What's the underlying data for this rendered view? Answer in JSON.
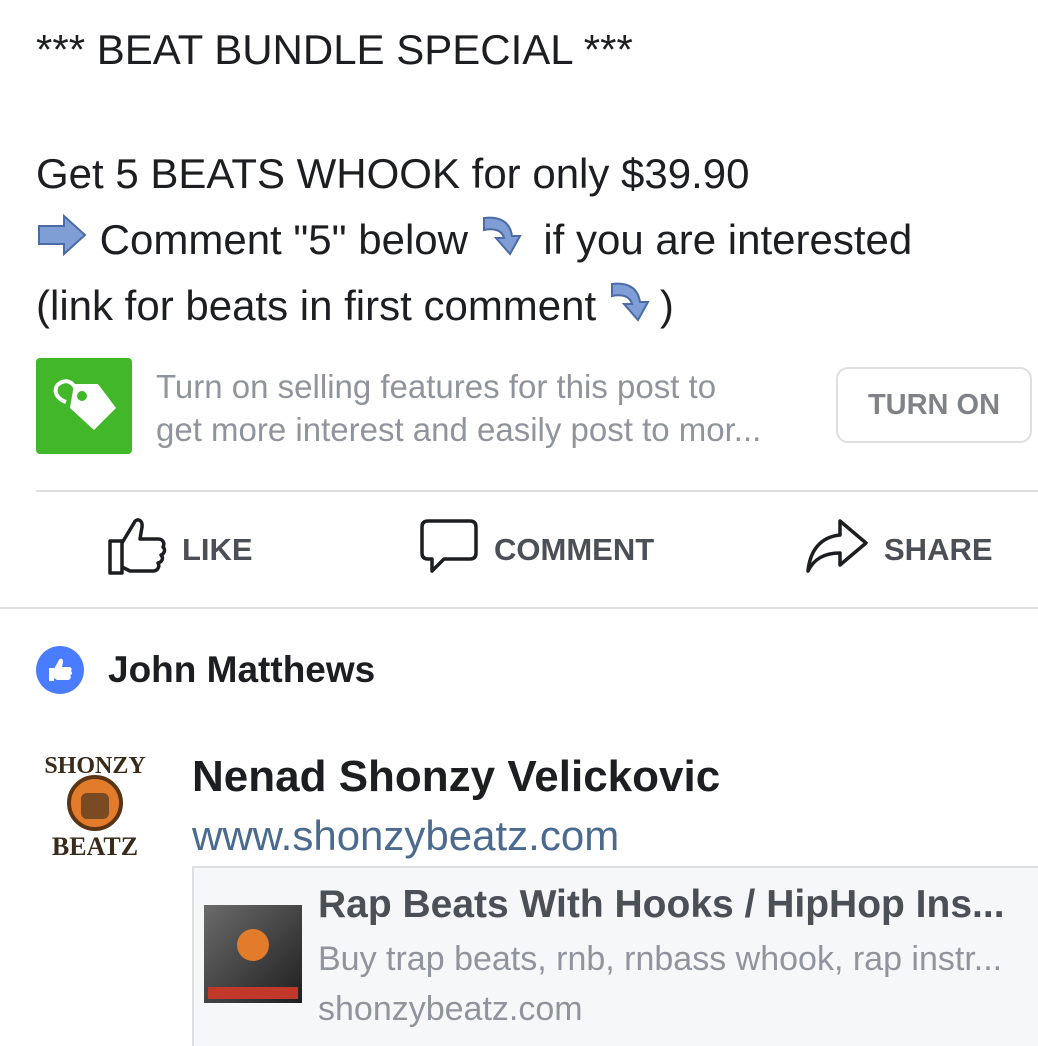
{
  "post": {
    "line1": "*** BEAT BUNDLE SPECIAL ***",
    "line2": "Get 5 BEATS WHOOK for only $39.90",
    "line3_a": "Comment \"5\" below",
    "line3_b": "if you are interested",
    "line4_a": "(link for beats in first comment",
    "line4_b": ")"
  },
  "selling": {
    "line1": "Turn on selling features for this post to",
    "line2": "get more interest and easily post to mor...",
    "button": "TURN ON",
    "icon": "price-tag-icon",
    "color": "#42b72a"
  },
  "actions": {
    "like": "LIKE",
    "comment": "COMMENT",
    "share": "SHARE"
  },
  "reactions": {
    "liker_name": "John Matthews",
    "badge_color": "#4a7cff"
  },
  "comment": {
    "author": "Nenad Shonzy Velickovic",
    "url": "www.shonzybeatz.com",
    "logo_text": [
      "SHONZY",
      "BEATZ"
    ],
    "link_card": {
      "title": "Rap Beats With Hooks / HipHop Ins...",
      "description": "Buy trap beats, rnb, rnbass whook, rap instr...",
      "domain": "shonzybeatz.com"
    }
  }
}
